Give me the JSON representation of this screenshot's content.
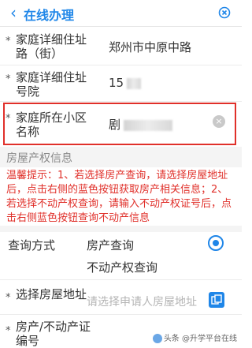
{
  "header": {
    "back_icon": "chevron-left-icon",
    "title": "在线办理",
    "close_icon": "close-circle-icon"
  },
  "fields": [
    {
      "required_mark": "*",
      "label": "家庭详细住址路（街）",
      "value": "郑州市中原中路"
    },
    {
      "required_mark": "*",
      "label": "家庭详细住址号院",
      "value": "15"
    },
    {
      "required_mark": "*",
      "label": "家庭所在小区名称",
      "value": "剧"
    }
  ],
  "section": {
    "title": "房屋产权信息",
    "tip": "温馨提示：1、若选择房产查询，请选择房屋地址后，点击右侧的蓝色按钮获取房产相关信息；2、若选择不动产权查询，请输入不动产权证号后，点击右侧蓝色按钮查询不动产信息"
  },
  "query": {
    "label": "查询方式",
    "options": [
      {
        "label": "房产查询",
        "selected": true
      },
      {
        "label": "不动产权查询",
        "selected": false
      }
    ]
  },
  "address": {
    "required_mark": "*",
    "label": "选择房屋地址",
    "placeholder": "请选择申请人房屋地址"
  },
  "cert": {
    "required_mark": "*",
    "label": "房产/不动产证编号"
  },
  "watermark": "头条 @升学平台在线",
  "colors": {
    "accent": "#1f86e8",
    "warning": "#e0302a"
  }
}
